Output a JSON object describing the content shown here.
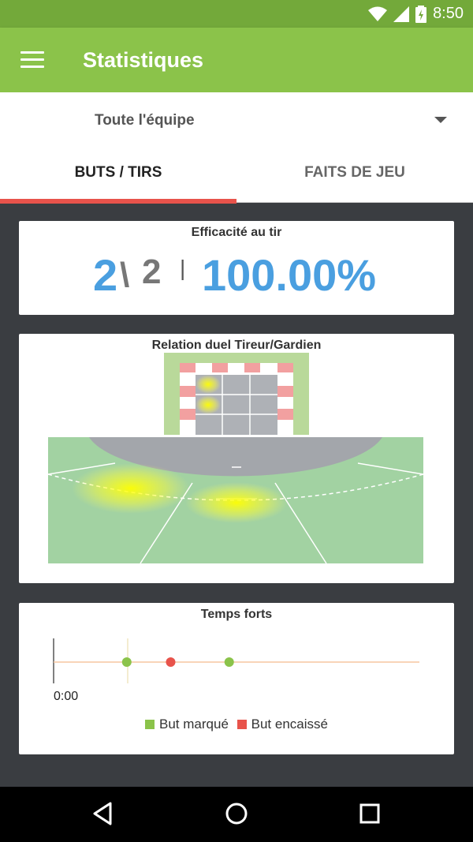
{
  "status_bar": {
    "time": "8:50",
    "icons": [
      "wifi-icon",
      "signal-icon",
      "battery-icon"
    ]
  },
  "app_bar": {
    "title": "Statistiques",
    "menu_icon": "menu-icon"
  },
  "selector": {
    "value": "Toute l'équipe"
  },
  "tabs": [
    {
      "label": "BUTS / TIRS",
      "active": true
    },
    {
      "label": "FAITS DE JEU",
      "active": false
    }
  ],
  "efficiency": {
    "title": "Efficacité au tir",
    "scored": "2",
    "separator": "\\",
    "total": "2",
    "divider": "|",
    "percentage": "100.00%"
  },
  "duel": {
    "title": "Relation duel Tireur/Gardien"
  },
  "timeline": {
    "title": "Temps forts",
    "start_label": "0:00",
    "events": [
      {
        "type": "scored",
        "position": 0.2
      },
      {
        "type": "conceded",
        "position": 0.32
      },
      {
        "type": "scored",
        "position": 0.48
      }
    ],
    "legend": [
      {
        "label": "But marqué",
        "color": "#8bc34a"
      },
      {
        "label": "But encaissé",
        "color": "#e8534b"
      }
    ]
  },
  "colors": {
    "accent": "#8bc34a",
    "tab_indicator": "#e8534b",
    "number_blue": "#4a9fe0"
  }
}
